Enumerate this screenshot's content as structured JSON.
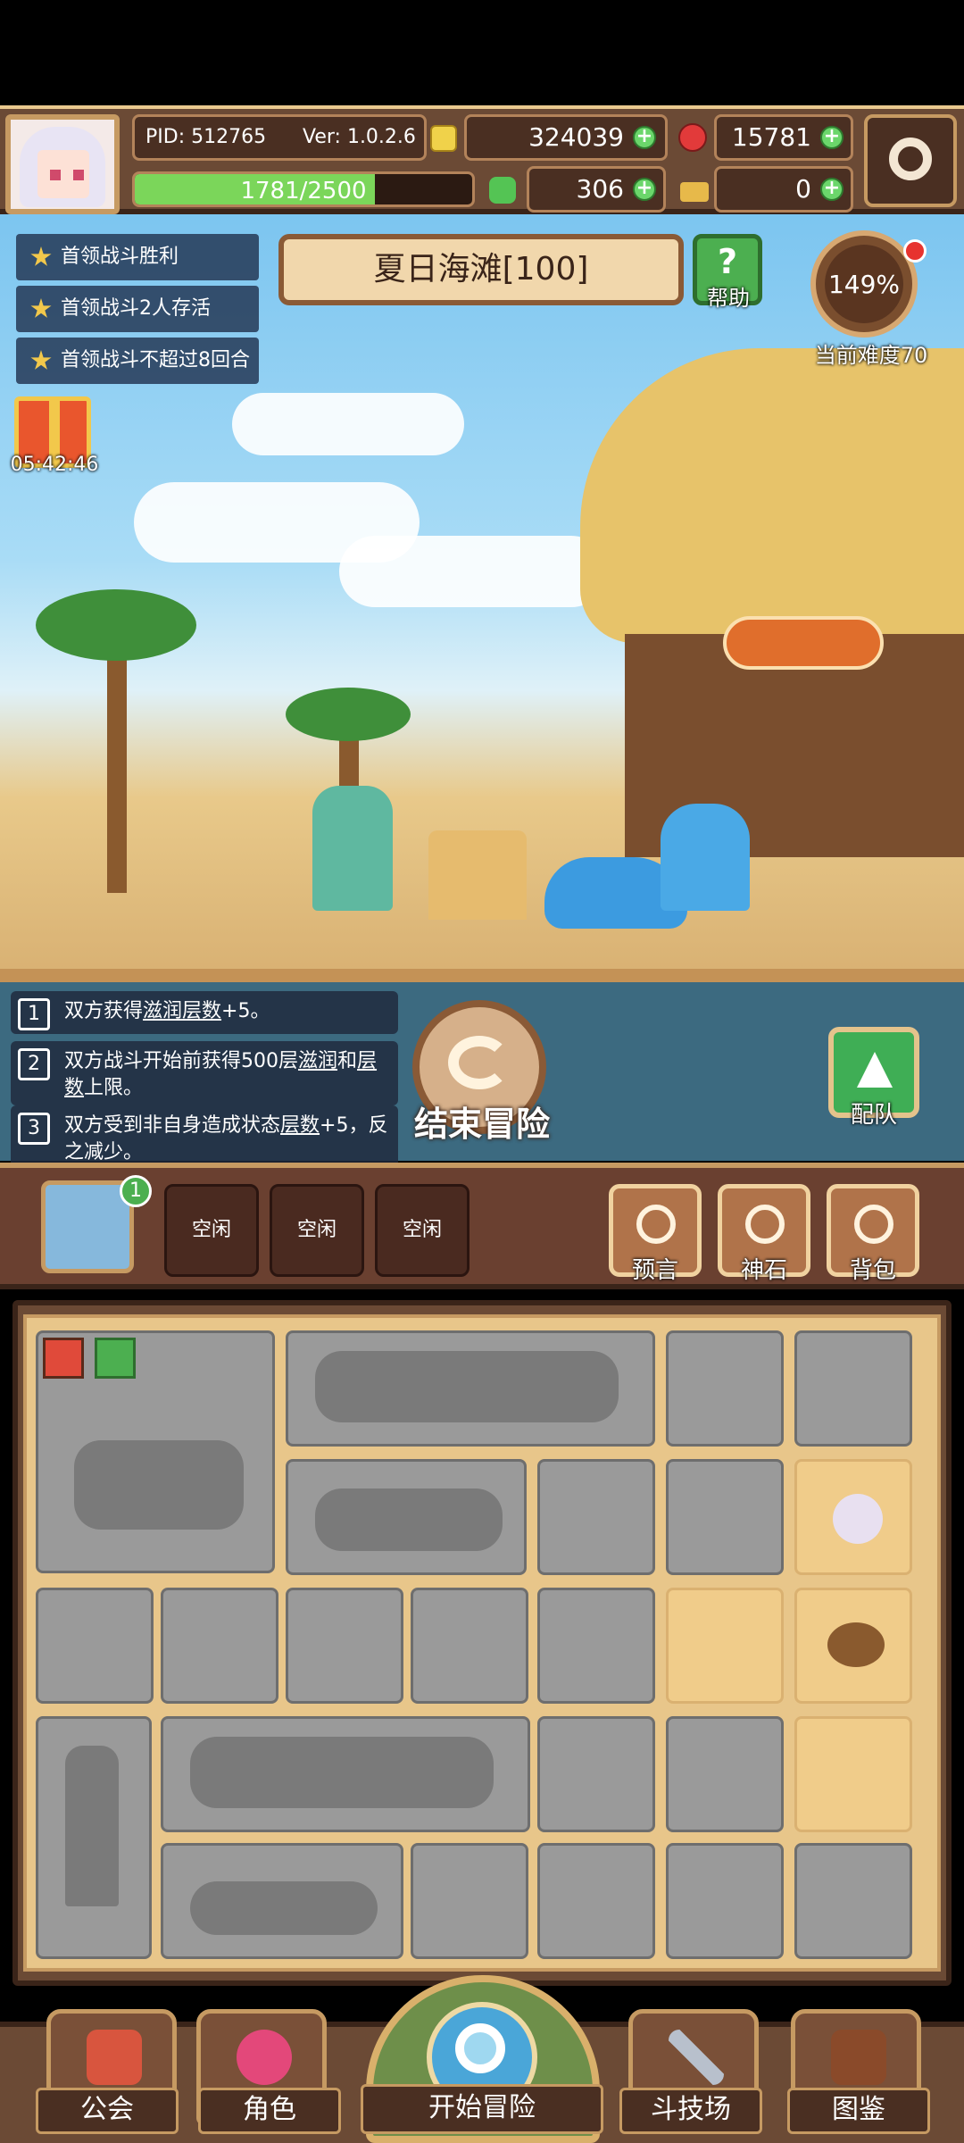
{
  "header": {
    "pid": "PID: 512765",
    "version": "Ver: 1.0.2.6",
    "gold": "324039",
    "ruby": "15781",
    "energy_text": "1781/2500",
    "energy_fraction": 0.7124,
    "clover": "306",
    "keys": "0"
  },
  "quests": [
    "首领战斗胜利",
    "首领战斗2人存活",
    "首领战斗不超过8回合"
  ],
  "stage": {
    "title": "夏日海滩[100]",
    "help_label": "帮助",
    "help_glyph": "?",
    "difficulty_percent": "149%",
    "difficulty_label": "当前难度70"
  },
  "gift": {
    "timer": "05:42:46"
  },
  "effects": {
    "e1": {
      "num": "1",
      "a": "双方获得",
      "b": "滋润层数",
      "c": "+5。"
    },
    "e2": {
      "num": "2",
      "a": "双方战斗开始前获得500层",
      "b": "滋润",
      "c": "和",
      "d": "层数",
      "e": "上限。"
    },
    "e3": {
      "num": "3",
      "a": "双方受到非自身造成状态",
      "b": "层数",
      "c": "+5，反之减少。"
    }
  },
  "actions": {
    "end_adventure": "结束冒险",
    "team": "配队"
  },
  "slots": {
    "badge": "1",
    "idle": [
      "空闲",
      "空闲",
      "空闲"
    ]
  },
  "tools": {
    "prophecy": "预言",
    "godstone": "神石",
    "backpack": "背包"
  },
  "nav": {
    "guild": "公会",
    "character": "角色",
    "start": "开始冒险",
    "arena": "斗技场",
    "codex": "图鉴"
  },
  "colors": {
    "wood_dark": "#3a2419",
    "wood": "#6b4a35",
    "gold_trim": "#c69a62",
    "accent_green": "#4caf50",
    "ruby": "#e23a3a"
  },
  "icons": [
    "gear-icon",
    "gold-coin-icon",
    "ruby-icon",
    "clover-icon",
    "key-icon",
    "star-icon",
    "help-icon",
    "gift-icon",
    "return-arrow-icon",
    "team-icon",
    "prophecy-icon",
    "godstone-icon",
    "backpack-icon",
    "magnifier-icon"
  ]
}
